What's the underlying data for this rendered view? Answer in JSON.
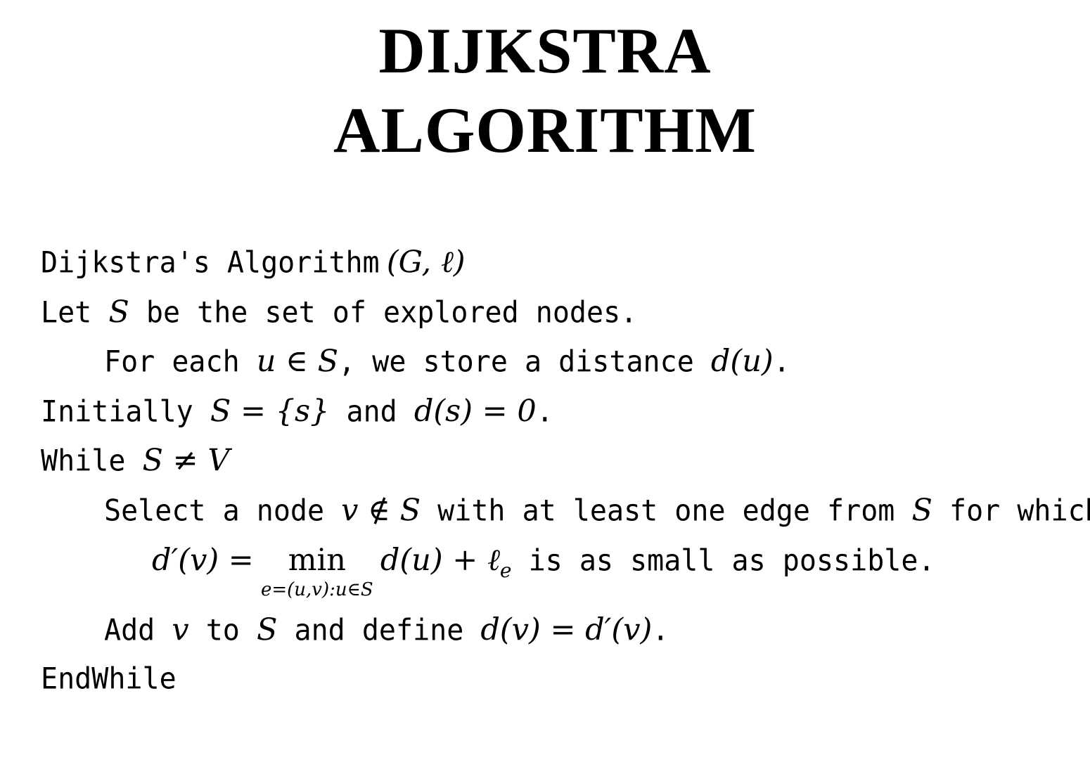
{
  "title": {
    "line1": "DIJKSTRA",
    "line2": "ALGORITHM"
  },
  "algorithm": {
    "header": {
      "text": "Dijkstra's Algorithm",
      "math": "(G, ℓ)"
    },
    "line1": {
      "t1": "Let ",
      "m1": "S",
      "t2": " be the set of explored nodes."
    },
    "line2": {
      "t1": "For each ",
      "m1": "u ∈ S",
      "t2": ", we store a distance ",
      "m2": "d(u)",
      "t3": "."
    },
    "line3": {
      "t1": "Initially ",
      "m1": "S = {s}",
      "t2": " and ",
      "m2": "d(s) = 0",
      "t3": "."
    },
    "line4": {
      "t1": "While ",
      "m1": "S ≠ V"
    },
    "line5": {
      "t1": "Select a node ",
      "m1": "v ∉ S",
      "t2": " with at least one edge from ",
      "m2": "S",
      "t3": " for which"
    },
    "line6": {
      "m1": "d′(v) =",
      "min": "min",
      "limits": "e=(u,v):u∈S",
      "m2": "d(u) + ℓ",
      "subscript": "e",
      "t1": " is as small as possible."
    },
    "line7": {
      "t1": "Add ",
      "m1": "v",
      "t2": " to ",
      "m2": "S",
      "t3": " and define ",
      "m3": "d(v) = d′(v)",
      "t4": "."
    },
    "footer": {
      "text": "EndWhile"
    }
  }
}
